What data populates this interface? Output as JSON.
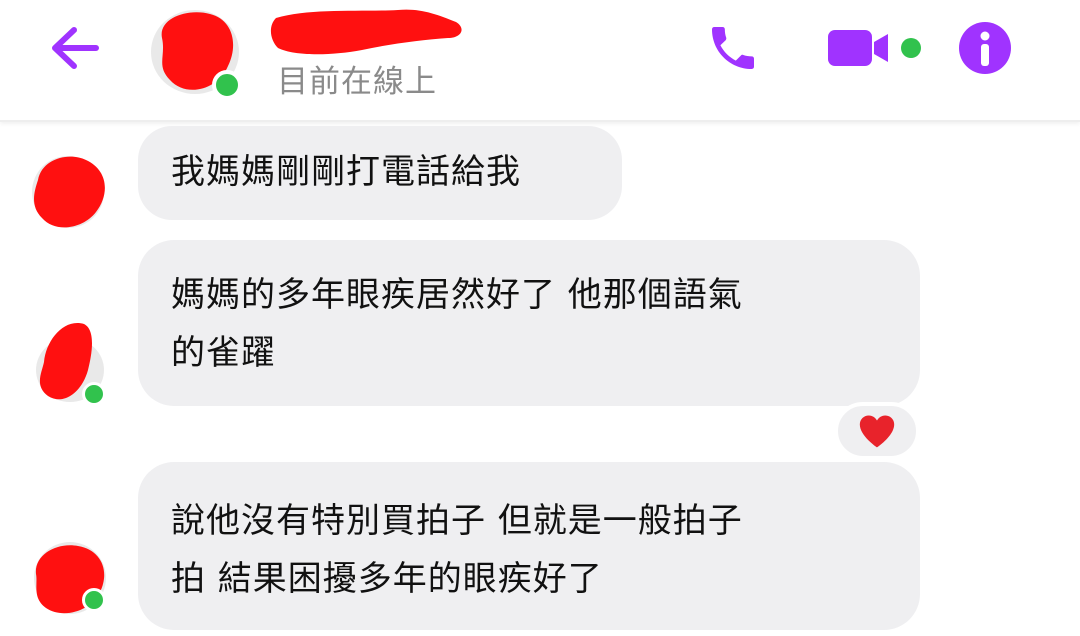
{
  "header": {
    "status": "目前在線上",
    "icons": {
      "back": "arrow-left-icon",
      "call": "phone-icon",
      "video": "video-camera-icon",
      "info": "info-icon"
    }
  },
  "colors": {
    "accent": "#a033ff",
    "online": "#31c24d",
    "bubble": "#efeff1",
    "redaction": "#ff0000",
    "reaction_heart": "#e8232b"
  },
  "messages": [
    {
      "lines": [
        "我媽媽剛剛打電話給我"
      ]
    },
    {
      "lines": [
        "媽媽的多年眼疾居然好了  他那個語氣",
        "的雀躍"
      ],
      "reaction": "heart-reaction"
    },
    {
      "lines": [
        "說他沒有特別買拍子 但就是一般拍子",
        "拍  結果困擾多年的眼疾好了"
      ]
    }
  ]
}
